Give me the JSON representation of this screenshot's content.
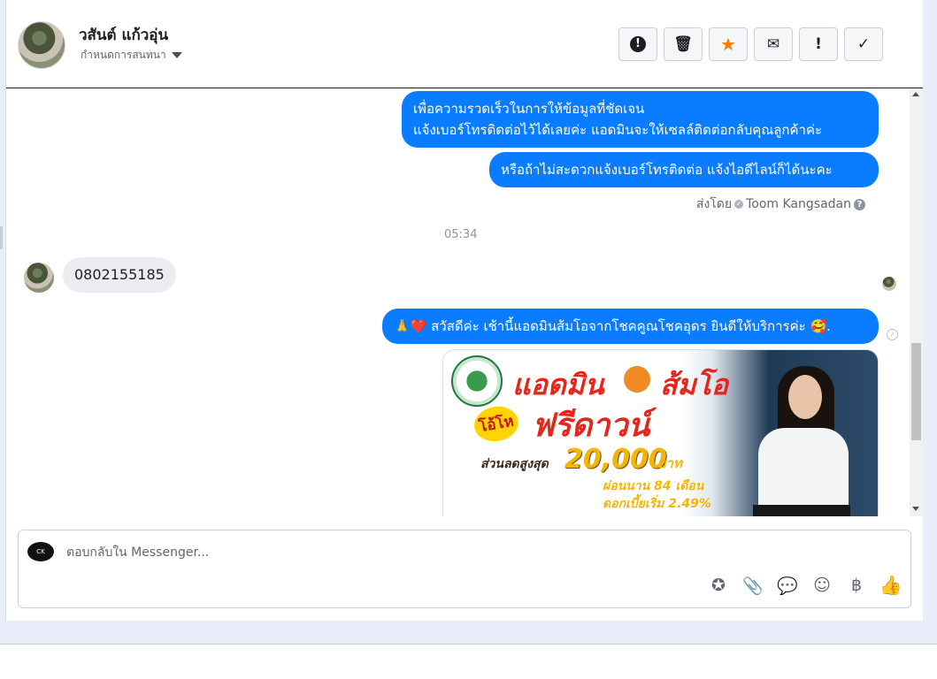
{
  "header": {
    "contact_name": "วสันต์ แก้วอุ่น",
    "assign_label": "กำหนดการสนทนา",
    "toolbar": [
      {
        "name": "report-button",
        "icon": "exclamation-circle-icon",
        "glyph": "!"
      },
      {
        "name": "delete-button",
        "icon": "trash-icon",
        "glyph": "🗑"
      },
      {
        "name": "star-button",
        "icon": "star-icon",
        "glyph": "★"
      },
      {
        "name": "mark-unread-button",
        "icon": "envelope-icon",
        "glyph": "✉"
      },
      {
        "name": "mark-important-button",
        "icon": "exclamation-icon",
        "glyph": "!"
      },
      {
        "name": "mark-done-button",
        "icon": "checkmark-icon",
        "glyph": "✓"
      }
    ]
  },
  "messages": {
    "out1_line1": "เพื่อความรวดเร็วในการให้ข้อมูลที่ชัดเจน",
    "out1_line2": "แจ้งเบอร์โทรติดต่อไว้ได้เลยค่ะ แอดมินจะให้เซลล์ติดต่อกลับคุณลูกค้าค่ะ",
    "out2": "หรือถ้าไม่สะดวกแจ้งเบอร์โทรติดต่อ แจ้งไอดีไลน์ก็ได้นะคะ",
    "sent_by_label": "ส่งโดย",
    "sent_by_name": "Toom Kangsadan",
    "timestamp": "05:34",
    "in1": "0802155185",
    "out3": "🙏❤️ สวัสดีค่ะ เช้านี้แอดมินส้มโอจากโชคคูณโชคอุดร ยินดีให้บริการค่ะ 🥰."
  },
  "promo": {
    "title_part1": "แอดมิน",
    "title_part2": "ส้มโอ",
    "bonus": "โอ้โห",
    "free_down": "ฟรีดาวน์",
    "discount_label": "ส่วนลดสูงสุด",
    "amount": "20,000",
    "currency": "บาท",
    "term": "ผ่อนนาน 84 เดือน",
    "rate": "ดอกเบี้ยเริ่ม 2.49%"
  },
  "composer": {
    "placeholder": "ตอบกลับใน Messenger...",
    "page_logo_text": "CK",
    "tools": [
      {
        "name": "saved-reply-button",
        "icon": "star-bubble-icon",
        "glyph": "✪"
      },
      {
        "name": "attach-button",
        "icon": "paperclip-icon",
        "glyph": "📎"
      },
      {
        "name": "quick-reply-button",
        "icon": "chat-bubble-icon",
        "glyph": "💬"
      },
      {
        "name": "emoji-button",
        "icon": "smiley-icon",
        "glyph": "☺"
      },
      {
        "name": "payment-button",
        "icon": "baht-icon",
        "glyph": "฿"
      },
      {
        "name": "like-button",
        "icon": "thumbs-up-icon",
        "glyph": "👍"
      }
    ]
  },
  "colors": {
    "outgoing_bubble": "#0a7cff",
    "incoming_bubble": "#ebedf0",
    "star_accent": "#f57c00"
  }
}
